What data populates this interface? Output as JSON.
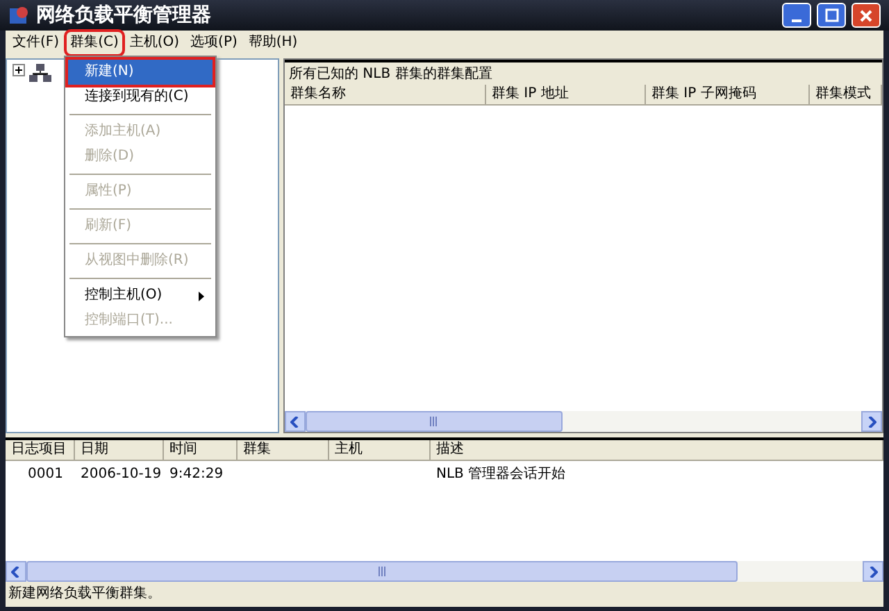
{
  "window": {
    "title": "网络负载平衡管理器"
  },
  "menu_bar": [
    {
      "label": "文件(F)",
      "selected": false
    },
    {
      "label": "群集(C)",
      "selected": true
    },
    {
      "label": "主机(O)",
      "selected": false
    },
    {
      "label": "选项(P)",
      "selected": false
    },
    {
      "label": "帮助(H)",
      "selected": false
    }
  ],
  "open_menu": [
    {
      "kind": "item",
      "label": "新建(N)",
      "selected": true,
      "disabled": false
    },
    {
      "kind": "item",
      "label": "连接到现有的(C)",
      "selected": false,
      "disabled": false
    },
    {
      "kind": "separator"
    },
    {
      "kind": "item",
      "label": "添加主机(A)",
      "selected": false,
      "disabled": true
    },
    {
      "kind": "item",
      "label": "删除(D)",
      "selected": false,
      "disabled": true
    },
    {
      "kind": "separator"
    },
    {
      "kind": "item",
      "label": "属性(P)",
      "selected": false,
      "disabled": true
    },
    {
      "kind": "separator"
    },
    {
      "kind": "item",
      "label": "刷新(F)",
      "selected": false,
      "disabled": true
    },
    {
      "kind": "separator"
    },
    {
      "kind": "item",
      "label": "从视图中删除(R)",
      "selected": false,
      "disabled": true
    },
    {
      "kind": "separator"
    },
    {
      "kind": "submenu",
      "label": "控制主机(O)",
      "selected": false,
      "disabled": false
    },
    {
      "kind": "item",
      "label": "控制端口(T)...",
      "selected": false,
      "disabled": true
    }
  ],
  "cluster_pane": {
    "title": "所有已知的 NLB 群集的群集配置",
    "columns": [
      "群集名称",
      "群集 IP 地址",
      "群集 IP 子网掩码",
      "群集模式"
    ]
  },
  "log_pane": {
    "columns": [
      "日志项目",
      "日期",
      "时间",
      "群集",
      "主机",
      "描述"
    ],
    "rows": [
      [
        "0001",
        "2006-10-19",
        "9:42:29",
        "",
        "",
        "NLB 管理器会话开始"
      ]
    ]
  },
  "status_bar": "新建网络负载平衡群集。"
}
